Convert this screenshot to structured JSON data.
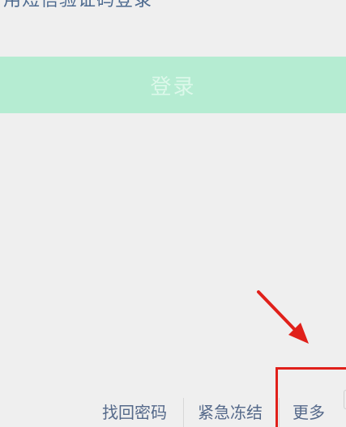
{
  "login_options": {
    "sms_login_label": "用短信验证码登录"
  },
  "login_button": {
    "label": "登录",
    "background_color": "#b5ecd2"
  },
  "footer": {
    "links": [
      {
        "label": "找回密码"
      },
      {
        "label": "紧急冻结"
      },
      {
        "label": "更多"
      }
    ]
  },
  "annotation": {
    "highlight_color": "#e0201a",
    "arrow_icon": "red-arrow-pointing-to-more"
  }
}
